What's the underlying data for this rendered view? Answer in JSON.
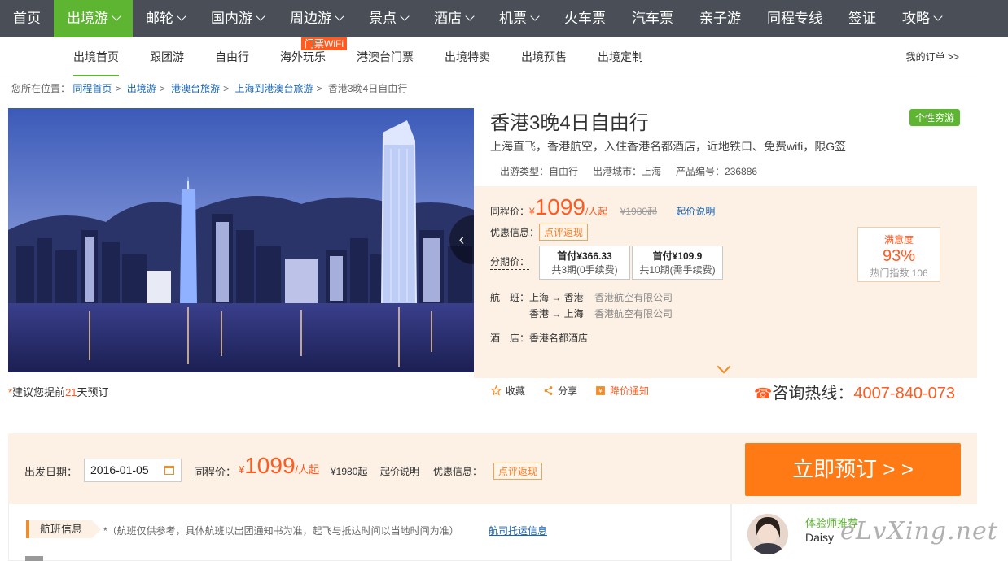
{
  "topnav": {
    "items": [
      {
        "label": "首页",
        "chev": false
      },
      {
        "label": "出境游",
        "chev": true
      },
      {
        "label": "邮轮",
        "chev": true
      },
      {
        "label": "国内游",
        "chev": true
      },
      {
        "label": "周边游",
        "chev": true
      },
      {
        "label": "景点",
        "chev": true
      },
      {
        "label": "酒店",
        "chev": true
      },
      {
        "label": "机票",
        "chev": true
      },
      {
        "label": "火车票",
        "chev": false
      },
      {
        "label": "汽车票",
        "chev": false
      },
      {
        "label": "亲子游",
        "chev": false
      },
      {
        "label": "同程专线",
        "chev": false
      },
      {
        "label": "签证",
        "chev": false
      },
      {
        "label": "攻略",
        "chev": true
      }
    ],
    "active_index": 1
  },
  "subnav": {
    "items": [
      "出境首页",
      "跟团游",
      "自由行",
      "海外玩乐",
      "港澳台门票",
      "出境特卖",
      "出境预售",
      "出境定制"
    ],
    "wifi_badge": "门票WiFi",
    "my_order": "我的订单 >>"
  },
  "breadcrumb": {
    "prefix": "您所在位置：",
    "links": [
      "同程首页",
      "出境游",
      "港澳台旅游",
      "上海到港澳台旅游"
    ],
    "current": "香港3晚4日自由行"
  },
  "product": {
    "title": "香港3晚4日自由行",
    "tag": "个性穷游",
    "subtitle": "上海直飞，香港航空，入住香港名都酒店，近地铁口、免费wifi，限G签",
    "type": "出游类型：自由行",
    "city": "出港城市：上海",
    "code": "产品编号：236886"
  },
  "pricing": {
    "label": "同程价：",
    "currency": "¥",
    "price": "1099",
    "unit": "/人起",
    "original": "¥1980起",
    "explain": "起价说明",
    "discount_label": "优惠信息：",
    "discount_tag": "点评返现",
    "installment_label": "分期价：",
    "installments": [
      {
        "head": "首付¥366.33",
        "sub": "共3期(0手续费)"
      },
      {
        "head": "首付¥109.9",
        "sub": "共10期(需手续费)"
      }
    ],
    "flight_label": "航　班：",
    "flights": [
      {
        "route": "上海 → 香港",
        "airline": "香港航空有限公司"
      },
      {
        "route": "香港 → 上海",
        "airline": "香港航空有限公司"
      }
    ],
    "hotel": "酒　店：香港名都酒店",
    "satisfaction": {
      "label": "满意度",
      "value": "93%",
      "hot": "热门指数 106"
    }
  },
  "advice": {
    "star": "*",
    "pre": "建议您提前",
    "days": "21",
    "post": "天预订"
  },
  "actions": {
    "favorite": "收藏",
    "share": "分享",
    "price_alert": "降价通知"
  },
  "hotline": {
    "label": "咨询热线：",
    "number": "4007-840-073"
  },
  "booking": {
    "date_label": "出发日期：",
    "date_value": "2016-01-05",
    "price_label": "同程价：",
    "currency": "¥",
    "price": "1099",
    "unit": "/人起",
    "original": "¥1980起",
    "explain": "起价说明",
    "discount_label": "优惠信息：",
    "discount_tag": "点评返现",
    "button": "立即预订 > >"
  },
  "flight_section": {
    "tab": "航班信息",
    "note": "*（航班仅供参考，具体航班以出团通知书为准，起飞与抵达时间以当地时间为准）",
    "link": "航司托运信息"
  },
  "advisor": {
    "label": "体验师推荐",
    "name": "Daisy"
  },
  "watermark": "eLvXing.net",
  "colors": {
    "nav_bg": "#4a4f57",
    "accent_green": "#5db532",
    "accent_orange": "#ff7a14",
    "price_red": "#ff5a1f",
    "link_blue": "#1a66b3",
    "panel_bg": "#fdf1e6"
  }
}
